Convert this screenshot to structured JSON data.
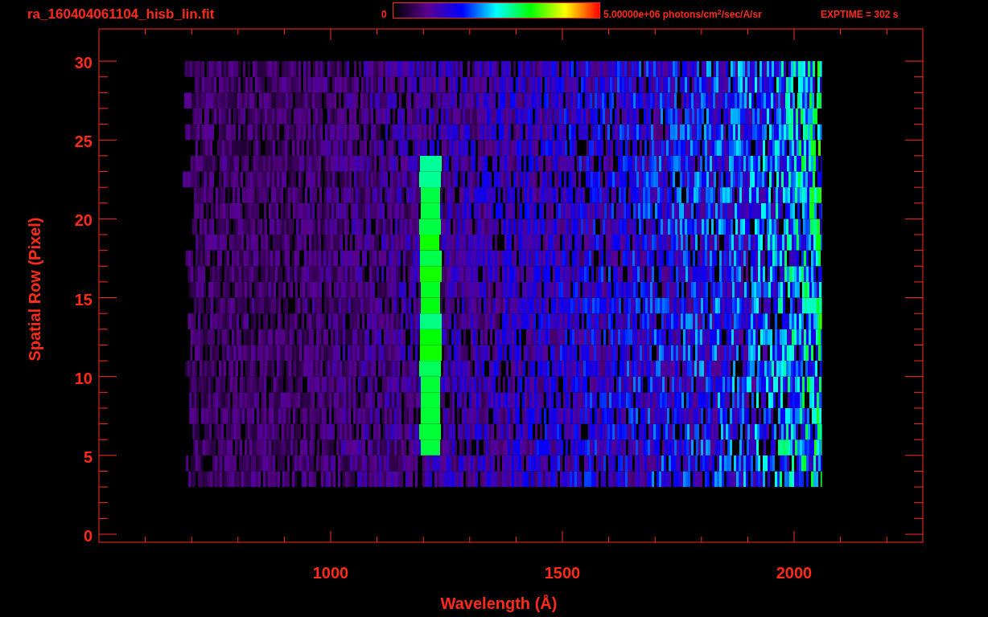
{
  "title": "ra_160404061104_hisb_lin.fit",
  "colorbar": {
    "min_label": "0",
    "max_label": "5.00000e+06 photons/cm$^{2}$/sec/A/sr"
  },
  "exptime": "EXPTIME = 302 s",
  "plot": {
    "xlabel": "Wavelength (Å)",
    "ylabel": "Spatial Row (Pixel)",
    "xticks": [
      "1000",
      "1500",
      "2000"
    ],
    "yticks": [
      "30",
      "25",
      "20",
      "15",
      "10",
      "5",
      "0"
    ]
  }
}
